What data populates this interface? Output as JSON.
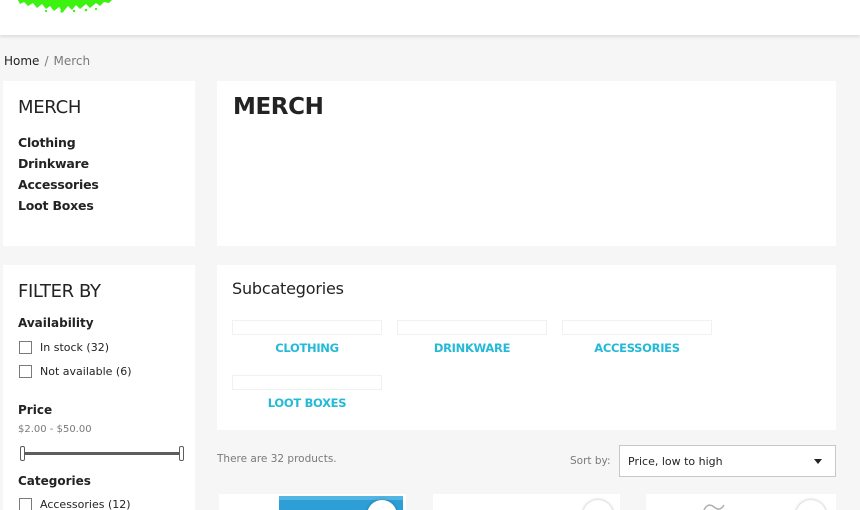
{
  "breadcrumb": {
    "home": "Home",
    "separator": "/",
    "current": "Merch"
  },
  "sidebar": {
    "title": "MERCH",
    "items": [
      {
        "label": "Clothing"
      },
      {
        "label": "Drinkware"
      },
      {
        "label": "Accessories"
      },
      {
        "label": "Loot Boxes"
      }
    ]
  },
  "main": {
    "title": "MERCH"
  },
  "filter": {
    "title": "FILTER BY",
    "availability": {
      "title": "Availability",
      "options": [
        {
          "label": "In stock (32)"
        },
        {
          "label": "Not available (6)"
        }
      ]
    },
    "price": {
      "title": "Price",
      "range": "$2.00 - $50.00"
    },
    "categories": {
      "title": "Categories",
      "options": [
        {
          "label": "Accessories (12)"
        }
      ]
    }
  },
  "subcategories": {
    "title": "Subcategories",
    "items": [
      {
        "label": "CLOTHING"
      },
      {
        "label": "DRINKWARE"
      },
      {
        "label": "ACCESSORIES"
      },
      {
        "label": "LOOT BOXES"
      }
    ]
  },
  "products": {
    "count_text": "There are 32 products.",
    "sort_label": "Sort by:",
    "sort_value": "Price, low to high"
  },
  "colors": {
    "accent": "#24b9d7",
    "logo": "#3cf210",
    "text": "#232323",
    "muted": "#7a7a7a",
    "background": "#f6f6f6"
  },
  "icons": {
    "logo": "green-brush-logo",
    "sort_caret": "caret-down-icon",
    "wishlist": "heart-icon"
  }
}
